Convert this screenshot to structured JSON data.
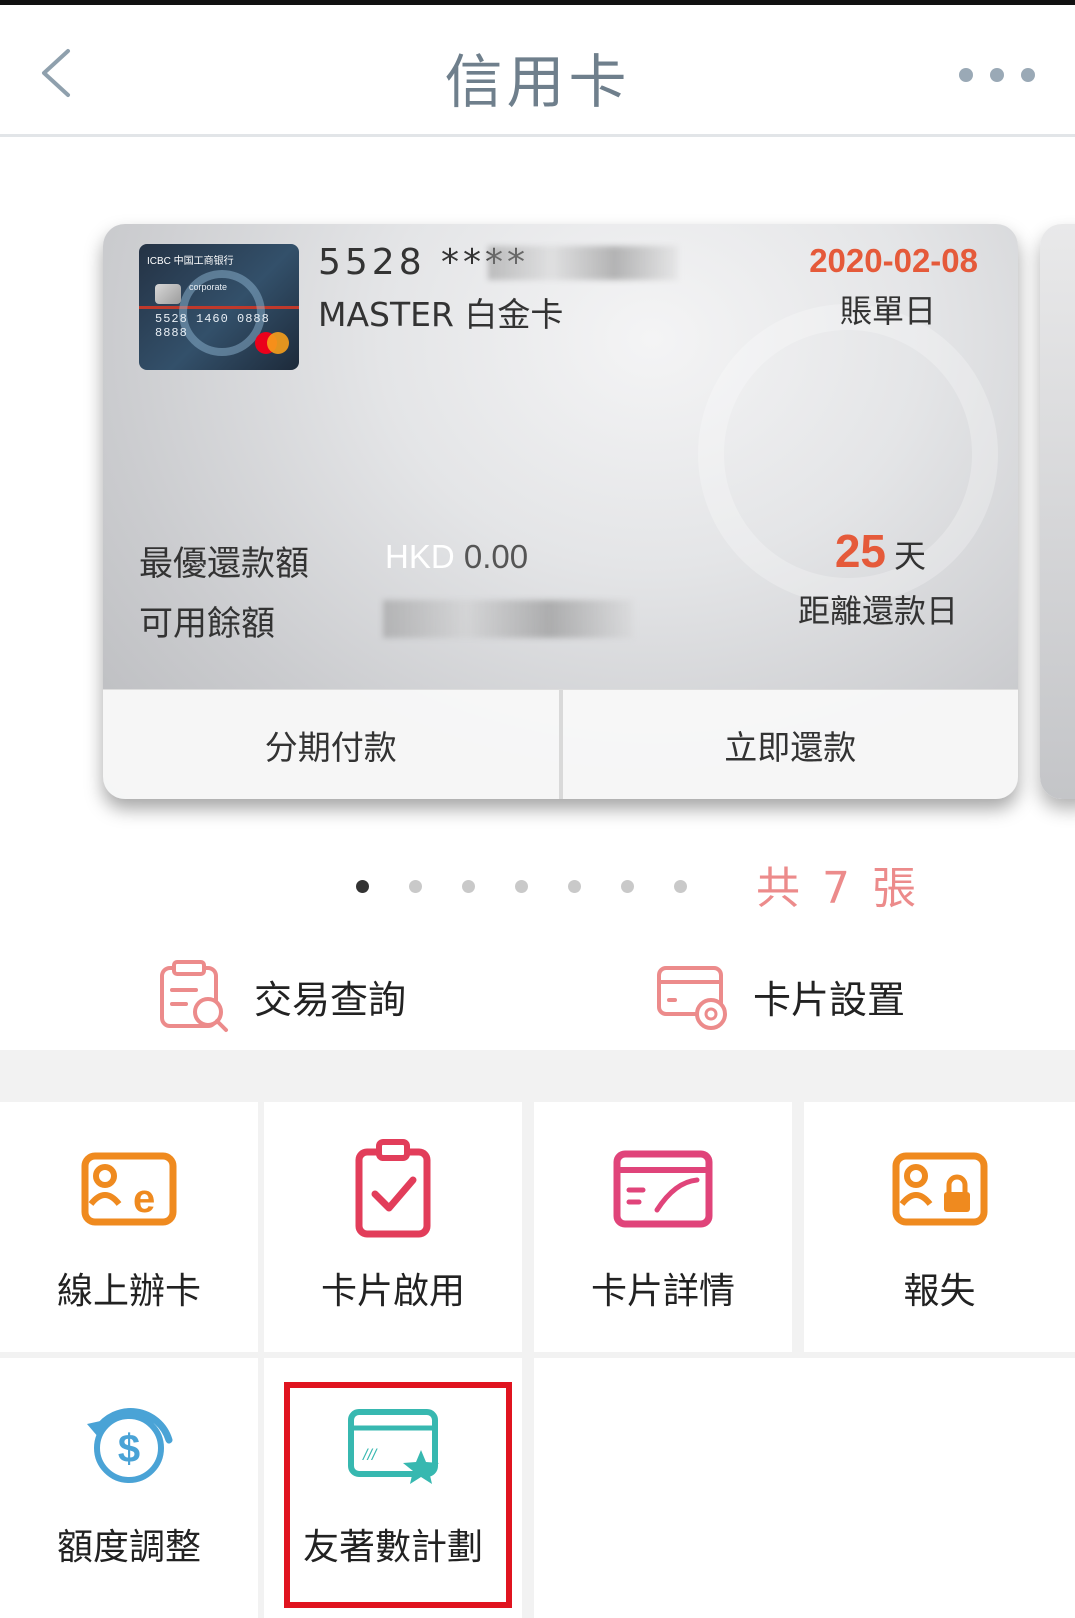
{
  "header": {
    "title": "信用卡"
  },
  "card": {
    "number_prefix": "5528 ****",
    "type": "MASTER 白金卡",
    "bill_date": "2020-02-08",
    "bill_date_label": "賬單日",
    "min_payment_label": "最優還款額",
    "min_payment_currency": "HKD",
    "min_payment_value": " 0.00",
    "available_label": "可用餘額",
    "days_value": "25",
    "days_unit": "天",
    "days_label": "距離還款日",
    "action_installment": "分期付款",
    "action_repay": "立即還款",
    "thumb": {
      "bank": "ICBC 中国工商银行",
      "corporate": "corporate",
      "number": "5528 1460 0888 8888"
    }
  },
  "pager": {
    "count_text": "共 7 張",
    "total": 7,
    "active_index": 0
  },
  "quick_links": [
    {
      "label": "交易查詢",
      "icon": "transaction-search-icon"
    },
    {
      "label": "卡片設置",
      "icon": "card-settings-icon"
    }
  ],
  "grid": [
    {
      "label": "線上辦卡",
      "icon": "online-apply-icon",
      "color": "#ef8a1f"
    },
    {
      "label": "卡片啟用",
      "icon": "card-activate-icon",
      "color": "#e23d5a"
    },
    {
      "label": "卡片詳情",
      "icon": "card-details-icon",
      "color": "#e0447a"
    },
    {
      "label": "報失",
      "icon": "report-loss-icon",
      "color": "#ef8a1f"
    },
    {
      "label": "額度調整",
      "icon": "limit-adjust-icon",
      "color": "#4aa3d6"
    },
    {
      "label": "友著數計劃",
      "icon": "rewards-plan-icon",
      "color": "#37b8b0"
    }
  ],
  "colors": {
    "accent_red": "#e55a3a",
    "highlight": "#e0141f",
    "count_pink": "#ec8b8b"
  }
}
